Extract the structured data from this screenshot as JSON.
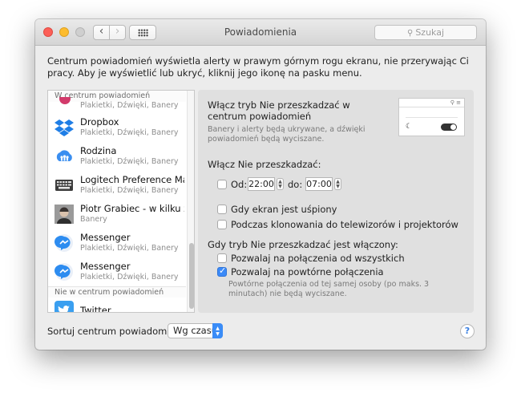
{
  "window": {
    "title": "Powiadomienia"
  },
  "toolbar": {
    "back": "‹",
    "forward": "›",
    "search_placeholder": "Szukaj",
    "search_icon": "⚲"
  },
  "intro": "Centrum powiadomień wyświetla alerty w prawym górnym rogu ekranu, nie przerywając Ci pracy. Aby je wyświetlić lub ukryć, kliknij jego ikonę na pasku menu.",
  "sidebar": {
    "section_in": "W centrum powiadomień",
    "section_out": "Nie w centrum powiadomień",
    "partial_subtitle": "Plakietki, Dźwięki, Banery",
    "items": [
      {
        "name": "Dropbox",
        "subtitle": "Plakietki, Dźwięki, Banery",
        "icon": "dropbox-icon"
      },
      {
        "name": "Rodzina",
        "subtitle": "Plakietki, Dźwięki, Banery",
        "icon": "family-icon"
      },
      {
        "name": "Logitech Preference Man…",
        "subtitle": "Plakietki, Dźwięki, Banery",
        "icon": "keyboard-icon"
      },
      {
        "name": "Piotr Grabiec - w kilku z…",
        "subtitle": "Banery",
        "icon": "avatar-icon"
      },
      {
        "name": "Messenger",
        "subtitle": "Plakietki, Dźwięki, Banery",
        "icon": "messenger-icon"
      },
      {
        "name": "Messenger",
        "subtitle": "Plakietki, Dźwięki, Banery",
        "icon": "messenger-icon"
      }
    ],
    "out_items": [
      {
        "name": "Twitter",
        "icon": "twitter-icon"
      }
    ]
  },
  "dnd": {
    "title": "Włącz tryb Nie przeszkadzać w centrum powiadomień",
    "description": "Banery i alerty będą ukrywane, a dźwięki powiadomień będą wyciszane.",
    "enable_heading": "Włącz Nie przeszkadzać:",
    "from_label": "Od:",
    "from_time": "22:00",
    "to_label": "do:",
    "to_time": "07:00",
    "screen_sleep": "Gdy ekran jest uśpiony",
    "mirroring": "Podczas klonowania do telewizorów i projektorów",
    "when_on_heading": "Gdy tryb Nie przeszkadzać jest włączony:",
    "allow_all_calls": "Pozwalaj na połączenia od wszystkich",
    "allow_repeated_calls": "Pozwalaj na powtórne połączenia",
    "repeated_note": "Powtórne połączenia od tej samej osoby (po maks. 3 minutach) nie będą wyciszane.",
    "checks": {
      "from": false,
      "screen_sleep": false,
      "mirroring": false,
      "allow_all": false,
      "allow_repeated": true
    }
  },
  "footer": {
    "sort_label": "Sortuj centrum powiadomień:",
    "sort_value": "Wg czasu",
    "help": "?"
  },
  "colors": {
    "accent": "#3b8af8",
    "close": "#fc5f57",
    "minimize": "#fdbc2e"
  }
}
